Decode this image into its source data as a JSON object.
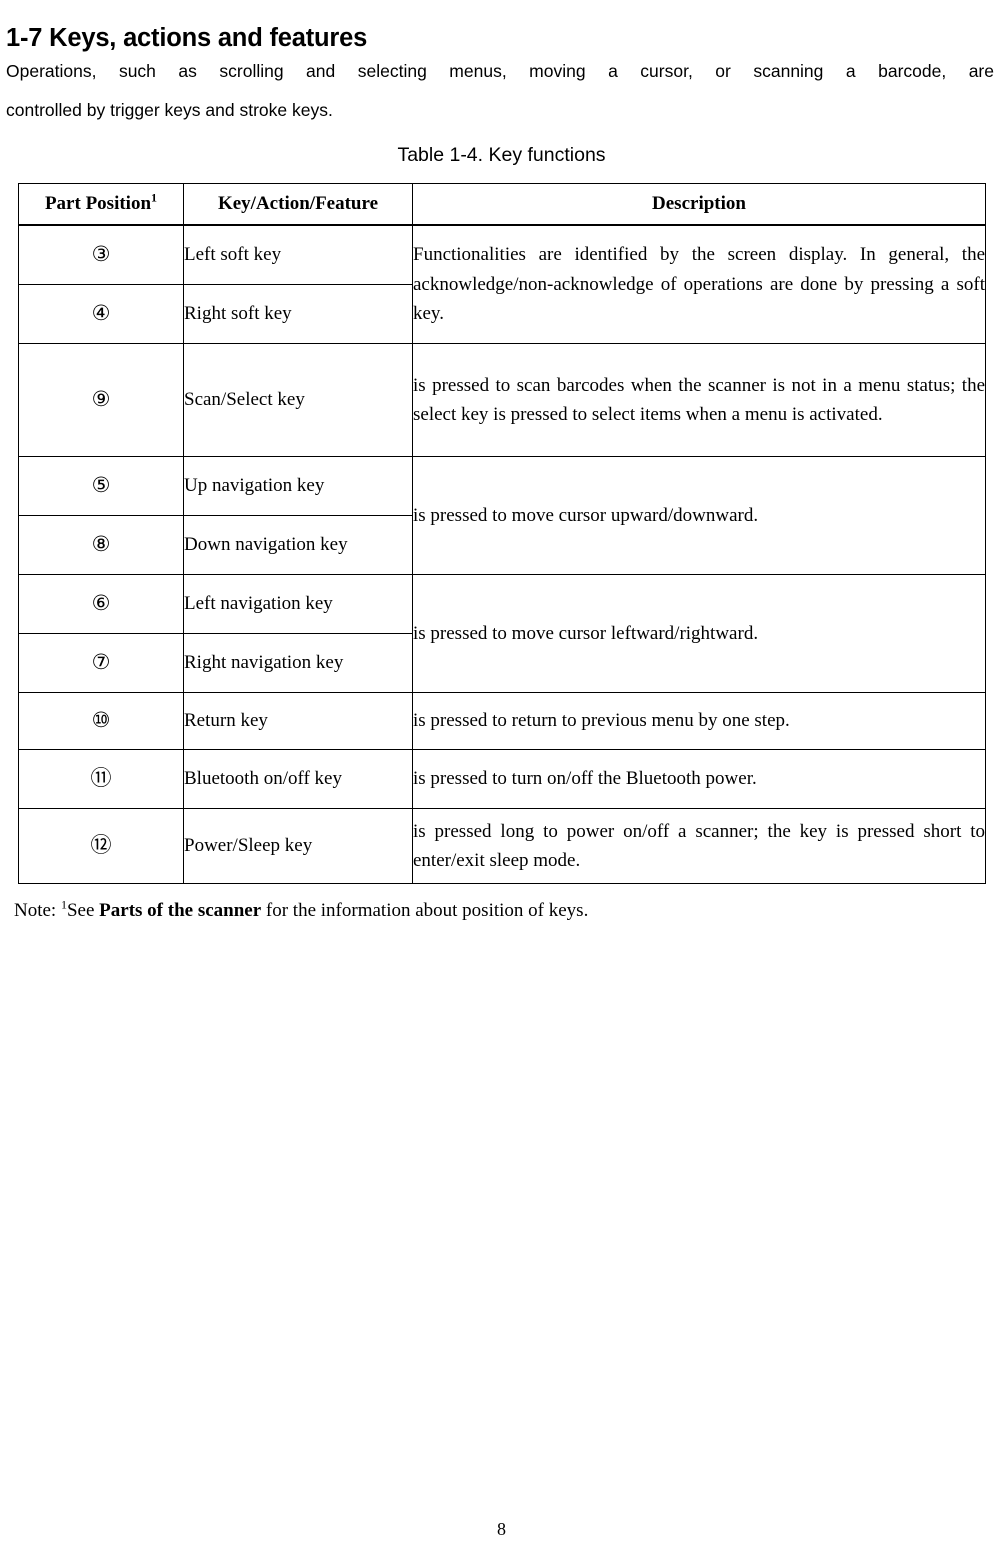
{
  "heading": "1-7 Keys, actions and features",
  "intro": {
    "line1": "Operations, such as scrolling and selecting menus, moving a cursor, or scanning a barcode, are",
    "line2": "controlled by trigger keys and stroke keys."
  },
  "table": {
    "caption": "Table 1-4. Key functions",
    "headers": {
      "position": "Part Position",
      "position_superscript": "1",
      "key": "Key/Action/Feature",
      "description": "Description"
    },
    "rows": [
      {
        "position": "③",
        "key": "Left soft key"
      },
      {
        "position": "④",
        "key": "Right soft key"
      },
      {
        "position": "⑨",
        "key": "Scan/Select key"
      },
      {
        "position": "⑤",
        "key": "Up navigation key"
      },
      {
        "position": "⑧",
        "key": "Down navigation key"
      },
      {
        "position": "⑥",
        "key": "Left navigation key"
      },
      {
        "position": "⑦",
        "key": "Right navigation key"
      },
      {
        "position": "⑩",
        "key": "Return key"
      },
      {
        "position": "⑪",
        "key": "Bluetooth on/off key"
      },
      {
        "position": "⑫",
        "key": "Power/Sleep key"
      }
    ],
    "descriptions": {
      "soft_keys": "Functionalities are identified by the screen display. In general, the acknowledge/non-acknowledge of operations are done by pressing a soft key.",
      "scan_select": "is pressed to scan barcodes when the scanner is not in a menu status; the select key is pressed to select items when a menu is activated.",
      "up_down": "is pressed to move cursor upward/downward.",
      "left_right": "is pressed to move cursor leftward/rightward.",
      "return": "is pressed to return to previous menu by one step.",
      "bluetooth": "is pressed to turn on/off the Bluetooth power.",
      "power_sleep": "is pressed long to power on/off a scanner; the key is pressed short to enter/exit sleep mode."
    }
  },
  "note": {
    "prefix": "Note: ",
    "superscript": "1",
    "text_before_bold": "See ",
    "bold_text": "Parts of the scanner",
    "text_after_bold": " for the information about position of keys."
  },
  "page_number": "8"
}
